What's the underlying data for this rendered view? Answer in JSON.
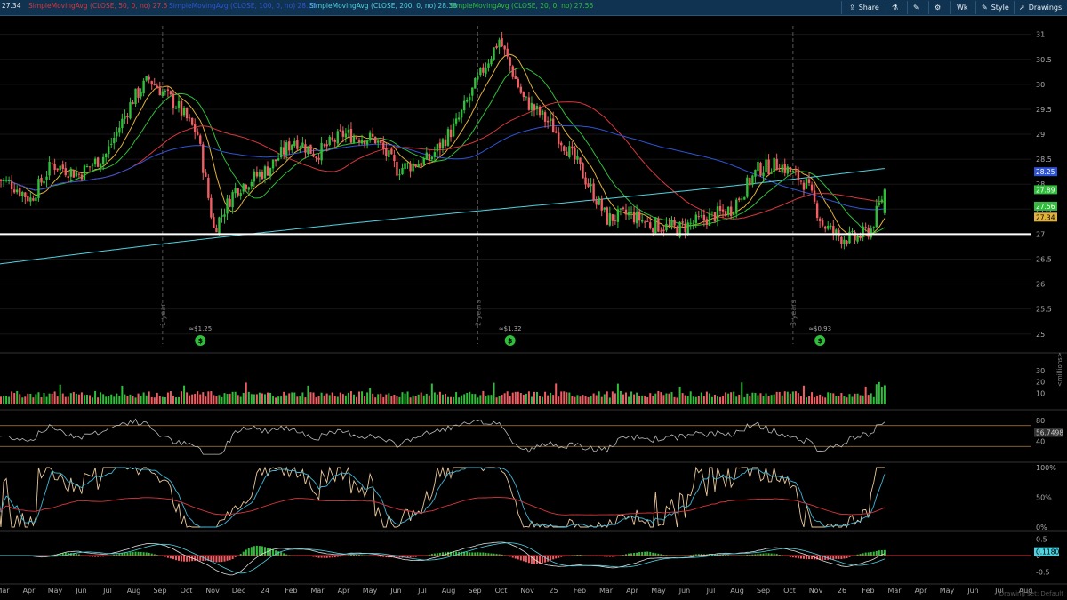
{
  "toolbar": {
    "share": "Share",
    "aggregation": "Wk",
    "style": "Style",
    "drawings": "Drawings"
  },
  "studies": [
    {
      "prefix": "",
      "label": "27.34",
      "value": "",
      "color": "#e8e8e8"
    },
    {
      "prefix": "",
      "label": "SimpleMovingAvg (CLOSE, 50, 0, no)",
      "value": "27.5",
      "color": "#d9363e"
    },
    {
      "prefix": "",
      "label": "SimpleMovingAvg (CLOSE, 100, 0, no)",
      "value": "28.25",
      "color": "#2f54d6"
    },
    {
      "prefix": "",
      "label": "SimpleMovingAvg (CLOSE, 200, 0, no)",
      "value": "28.38",
      "color": "#4fd3e0"
    },
    {
      "prefix": "",
      "label": "SimpleMovingAvg (CLOSE, 20, 0, no)",
      "value": "27.56",
      "color": "#2fbf3a"
    }
  ],
  "status": {
    "drawing_set": "Drawing set: Default"
  },
  "chart_data": {
    "type": "candlestick",
    "price_axis": {
      "ticks": [
        "31",
        "30.5",
        "30",
        "29.5",
        "29",
        "28.5",
        "28",
        "27.5",
        "27",
        "26.5",
        "26",
        "25.5",
        "25"
      ],
      "ylim": [
        24.8,
        31.35
      ]
    },
    "price_labels": [
      {
        "label": "28.25",
        "value": 28.25,
        "color": "#2f54d6"
      },
      {
        "label": "27.89",
        "value": 27.89,
        "color": "#2fbf3a"
      },
      {
        "label": "27.56",
        "value": 27.56,
        "color": "#2fbf3a"
      },
      {
        "label": "27.34",
        "value": 27.34,
        "color": "#e0b23a"
      }
    ],
    "horizontal_line": 27.0,
    "time_axis": [
      "Mar",
      "Apr",
      "May",
      "Jun",
      "Jul",
      "Aug",
      "Sep",
      "Oct",
      "Nov",
      "Dec",
      "24",
      "Feb",
      "Mar",
      "Apr",
      "May",
      "Jun",
      "Jul",
      "Aug",
      "Sep",
      "Oct",
      "Nov",
      "25",
      "Feb",
      "Mar",
      "Apr",
      "May",
      "Jun",
      "Jul",
      "Aug",
      "Sep",
      "Oct",
      "Nov",
      "26",
      "Feb",
      "Mar",
      "Apr",
      "May",
      "Jun",
      "Jul",
      "Aug"
    ],
    "period_markers": [
      {
        "label": "1 year",
        "week": 61
      },
      {
        "label": "2 years",
        "week": 178
      },
      {
        "label": "3 years",
        "week": 295
      }
    ],
    "dividends": [
      {
        "label": "≈$1.25",
        "week": 75
      },
      {
        "label": "≈$1.32",
        "week": 190
      },
      {
        "label": "≈$0.93",
        "week": 305
      }
    ],
    "volume": {
      "axis_label": "<millions>",
      "ticks": [
        "30",
        "20",
        "10"
      ],
      "ylim": [
        0,
        38
      ]
    },
    "oscillator": {
      "ticks": [
        "80",
        "40"
      ],
      "last_value": "56.7498",
      "last_color": "#cccccc"
    },
    "stochastic": {
      "ticks": [
        "100%",
        "50%",
        "0%"
      ]
    },
    "macd": {
      "ticks": [
        "0.5",
        "0",
        "-0.5"
      ],
      "last_value": "0.1180",
      "last_color": "#4fd3e0"
    },
    "series_summary": {
      "start_price": 28.1,
      "end_price": 27.89,
      "high": 31.05,
      "low": 26.4
    }
  }
}
